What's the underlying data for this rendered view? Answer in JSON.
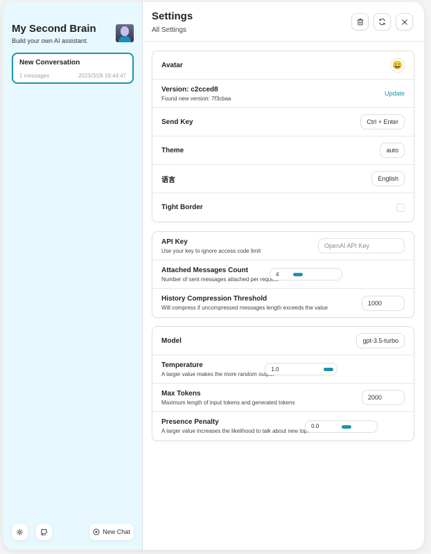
{
  "sidebar": {
    "title": "My Second Brain",
    "subtitle": "Build your own AI assistant.",
    "chats": [
      {
        "title": "New Conversation",
        "count": "1 messages",
        "time": "2023/3/28 19:44:47"
      }
    ],
    "settings_icon": "settings-icon",
    "github_icon": "github-icon",
    "new_chat_label": "New Chat"
  },
  "header": {
    "title": "Settings",
    "subtitle": "All Settings",
    "buttons": [
      "clear-icon",
      "reset-icon",
      "close-icon"
    ]
  },
  "general": {
    "avatar": {
      "label": "Avatar",
      "value": "😀"
    },
    "version": {
      "label": "Version: c2cced8",
      "sub": "Found new version: 7f3cbaa",
      "action": "Update"
    },
    "send_key": {
      "label": "Send Key",
      "value": "Ctrl + Enter"
    },
    "theme": {
      "label": "Theme",
      "value": "auto"
    },
    "language": {
      "label": "语言",
      "value": "English"
    },
    "tight_border": {
      "label": "Tight Border",
      "checked": false
    }
  },
  "api": {
    "api_key": {
      "label": "API Key",
      "sub": "Use your key to ignore access code limit",
      "placeholder": "OpenAI API Key"
    },
    "attached": {
      "label": "Attached Messages Count",
      "sub": "Number of sent messages attached per request",
      "value": "4",
      "fraction": 0.2
    },
    "history": {
      "label": "History Compression Threshold",
      "sub": "Will compress if uncompressed messages length exceeds the value",
      "value": "1000"
    }
  },
  "model": {
    "model": {
      "label": "Model",
      "value": "gpt-3.5-turbo"
    },
    "temperature": {
      "label": "Temperature",
      "sub": "A larger value makes the more random output",
      "value": "1.0",
      "fraction": 1.0
    },
    "max_tokens": {
      "label": "Max Tokens",
      "sub": "Maximum length of input tokens and generated tokens",
      "value": "2000"
    },
    "presence": {
      "label": "Presence Penalty",
      "sub": "A larger value increases the likelihood to talk about new topics",
      "value": "0.0",
      "fraction": 0.5
    }
  },
  "colors": {
    "accent": "#1d93ab",
    "sidebar_bg": "#e7f8ff"
  }
}
